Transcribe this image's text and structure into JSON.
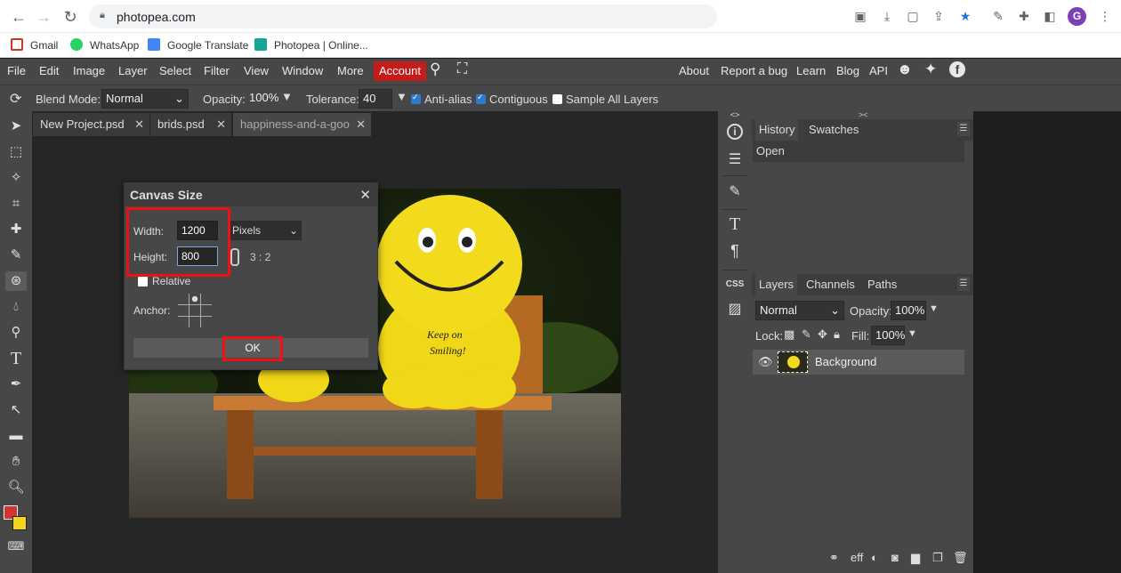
{
  "browser": {
    "url": "photopea.com",
    "bookmarks": [
      "Gmail",
      "WhatsApp",
      "Google Translate",
      "Photopea | Online..."
    ],
    "avatar_letter": "G"
  },
  "menu": {
    "items": [
      "File",
      "Edit",
      "Image",
      "Layer",
      "Select",
      "Filter",
      "View",
      "Window",
      "More"
    ],
    "account": "Account",
    "right_items": [
      "About",
      "Report a bug",
      "Learn",
      "Blog",
      "API"
    ]
  },
  "options": {
    "blend_mode_label": "Blend Mode:",
    "blend_mode_value": "Normal",
    "opacity_label": "Opacity:",
    "opacity_value": "100%",
    "tolerance_label": "Tolerance:",
    "tolerance_value": "40",
    "antialias_label": "Anti-alias",
    "contiguous_label": "Contiguous",
    "sample_all_label": "Sample All Layers"
  },
  "tabs": [
    {
      "label": "New Project.psd"
    },
    {
      "label": "brids.psd"
    },
    {
      "label": "happiness-and-a-goo"
    }
  ],
  "dialog": {
    "title": "Canvas Size",
    "width_label": "Width:",
    "width_value": "1200",
    "unit_value": "Pixels",
    "height_label": "Height:",
    "height_value": "800",
    "ratio": "3 : 2",
    "relative_label": "Relative",
    "anchor_label": "Anchor:",
    "ok_label": "OK"
  },
  "history_panel": {
    "tabs": [
      "History",
      "Swatches"
    ],
    "items": [
      "Open"
    ]
  },
  "layers_panel": {
    "tabs": [
      "Layers",
      "Channels",
      "Paths"
    ],
    "blend_value": "Normal",
    "opacity_label": "Opacity:",
    "opacity_value": "100%",
    "lock_label": "Lock:",
    "fill_label": "Fill:",
    "fill_value": "100%",
    "layers": [
      "Background"
    ],
    "footer_eff": "eff"
  },
  "image_text": {
    "line1": "Keep on",
    "line2": "Smiling!"
  },
  "colors": {
    "account_bg": "#c41b1b",
    "highlight_box": "#ee1111",
    "foreground": "#d33333",
    "background": "#f2d51b"
  }
}
